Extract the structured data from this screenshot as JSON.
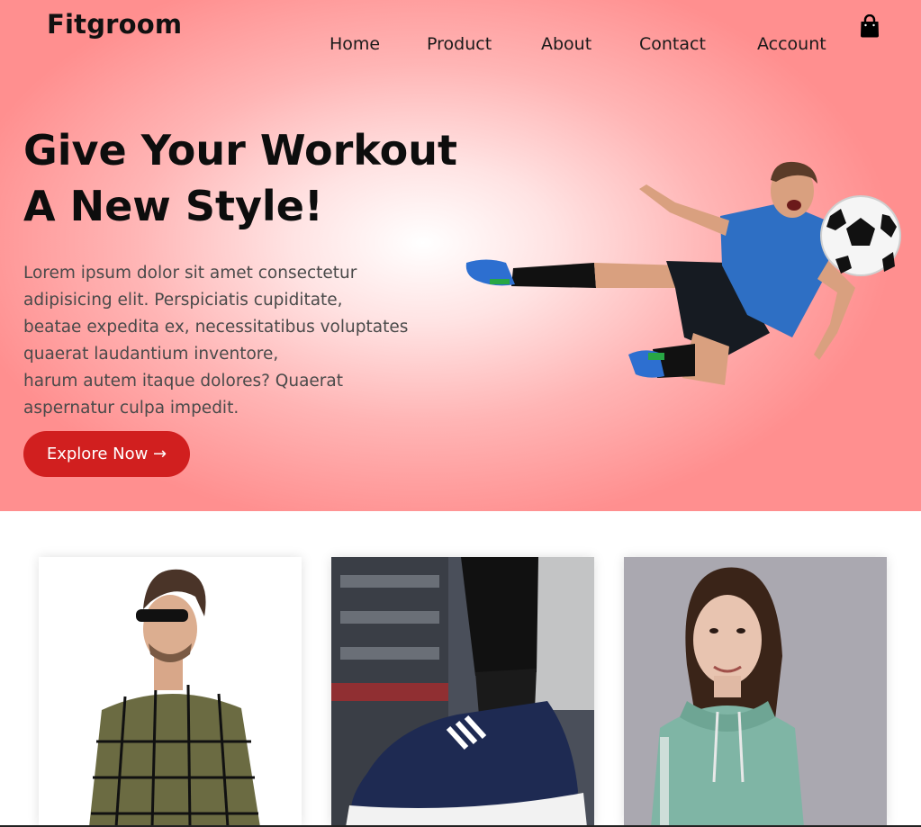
{
  "header": {
    "brand": "Fitgroom",
    "nav": [
      {
        "label": "Home"
      },
      {
        "label": "Product"
      },
      {
        "label": "About"
      },
      {
        "label": "Contact"
      },
      {
        "label": "Account"
      }
    ],
    "cart_icon": "shopping-bag-icon"
  },
  "hero": {
    "headline_line1": "Give Your Workout",
    "headline_line2": "A New Style!",
    "paragraph_lines": [
      "Lorem ipsum dolor sit amet consectetur",
      "adipisicing elit. Perspiciatis cupiditate,",
      "beatae expedita ex, necessitatibus voluptates",
      "quaerat laudantium inventore,",
      "harum autem itaque dolores? Quaerat",
      "aspernatur culpa impedit."
    ],
    "cta_label": "Explore Now →",
    "image": "soccer-player-kicking-ball"
  },
  "products": [
    {
      "image": "man-in-checked-sweater"
    },
    {
      "image": "navy-sneaker-on-foot"
    },
    {
      "image": "woman-in-mint-hoodie"
    }
  ],
  "colors": {
    "cta": "#d11f1f",
    "hero_edge": "#ff8f8f",
    "hero_center": "#ffffff"
  }
}
